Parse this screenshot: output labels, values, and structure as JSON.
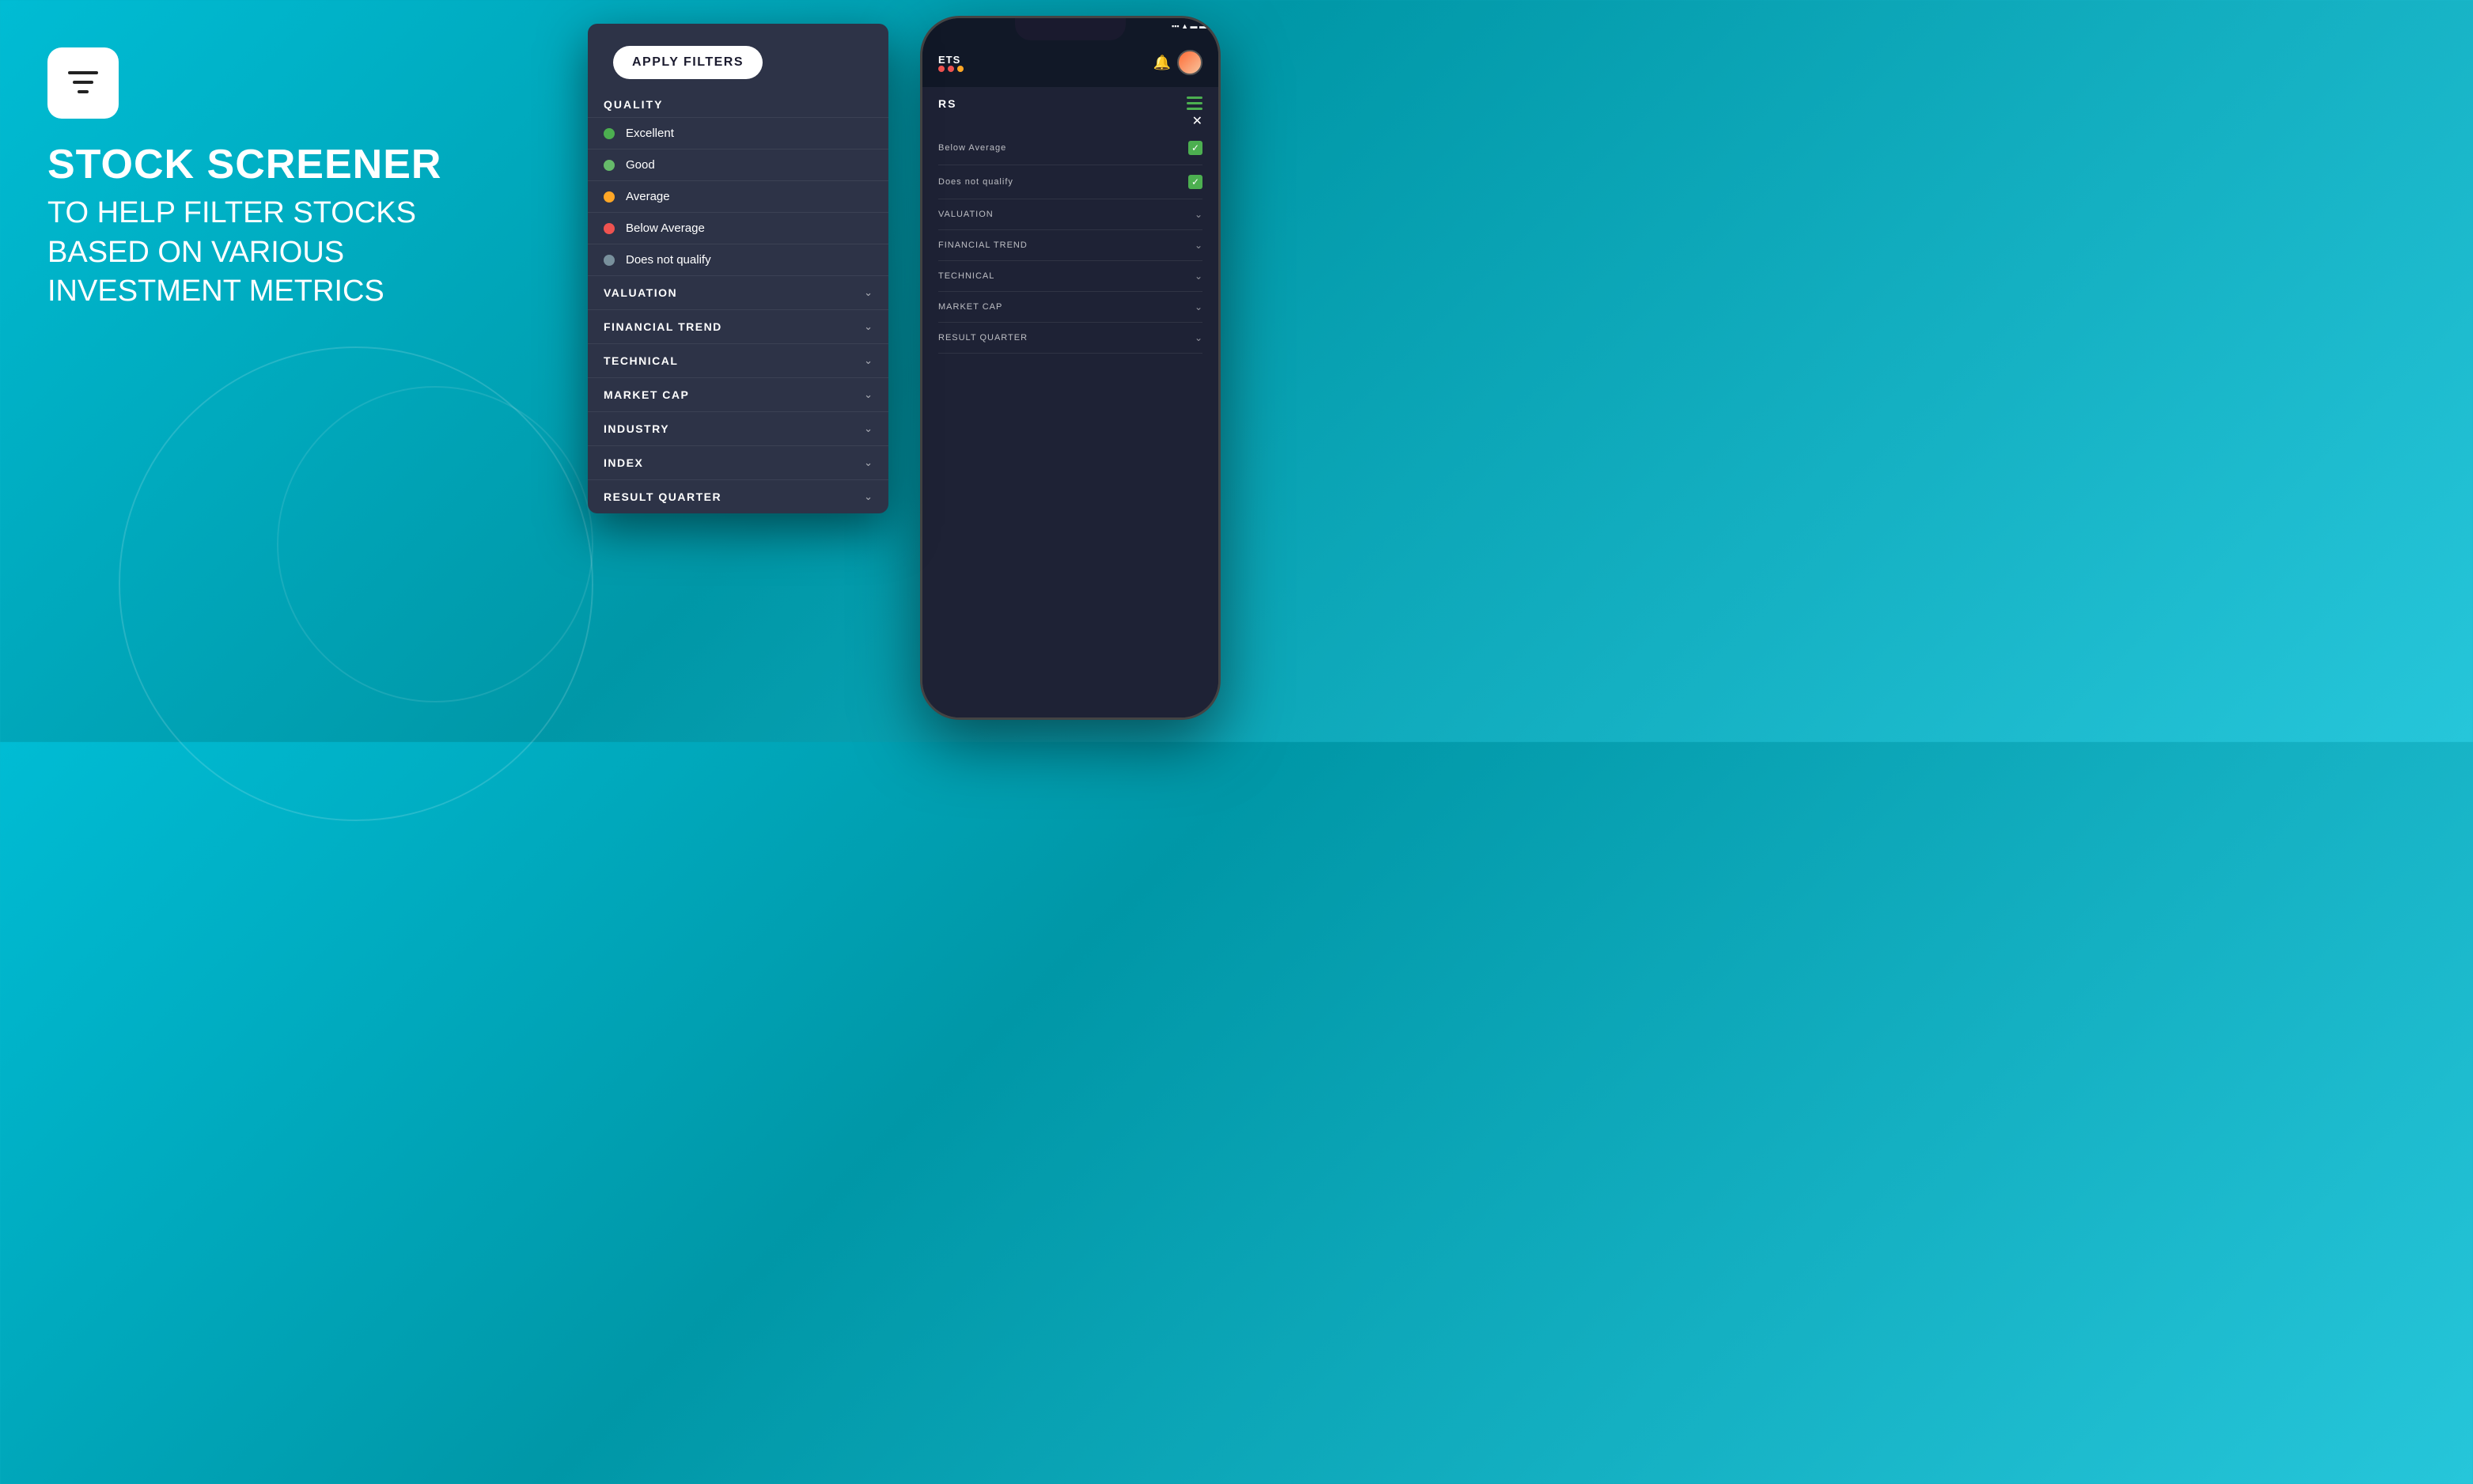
{
  "background": {
    "gradient_start": "#00bcd4",
    "gradient_end": "#0097a7"
  },
  "left": {
    "icon_label": "filter-icon",
    "title_line1": "STOCK SCREENER",
    "title_line2": "TO HELP FILTER STOCKS",
    "title_line3": "BASED ON VARIOUS",
    "title_line4": "INVESTMENT METRICS"
  },
  "dropdown": {
    "apply_button": "APPLY FILTERS",
    "quality_header": "QUALITY",
    "quality_items": [
      {
        "label": "Excellent",
        "dot_class": "dot-green-bright"
      },
      {
        "label": "Good",
        "dot_class": "dot-green"
      },
      {
        "label": "Average",
        "dot_class": "dot-orange"
      },
      {
        "label": "Below Average",
        "dot_class": "dot-red"
      },
      {
        "label": "Does not qualify",
        "dot_class": "dot-gray"
      }
    ],
    "categories": [
      {
        "label": "VALUATION"
      },
      {
        "label": "FINANCIAL TREND"
      },
      {
        "label": "TECHNICAL"
      },
      {
        "label": "MARKET CAP"
      },
      {
        "label": "INDUSTRY"
      },
      {
        "label": "INDEX"
      },
      {
        "label": "RESULT QUARTER"
      }
    ]
  },
  "phone": {
    "header_text": "ETS",
    "subheader_text": "RS",
    "close_symbol": "✕",
    "filter_rows": [
      {
        "label": "Below Average",
        "type": "checkbox"
      },
      {
        "label": "Does not qualify",
        "type": "checkbox"
      },
      {
        "label": "VALUATION",
        "type": "chevron"
      },
      {
        "label": "FINANCIAL TREND",
        "type": "chevron"
      },
      {
        "label": "TECHNICAL",
        "type": "chevron"
      },
      {
        "label": "MARKET CAP",
        "type": "chevron"
      },
      {
        "label": "RESULT QUARTER",
        "type": "chevron"
      }
    ]
  },
  "icons": {
    "chevron_down": "⌄",
    "checkmark": "✓",
    "bell": "🔔",
    "hamburger_lines": 3
  }
}
